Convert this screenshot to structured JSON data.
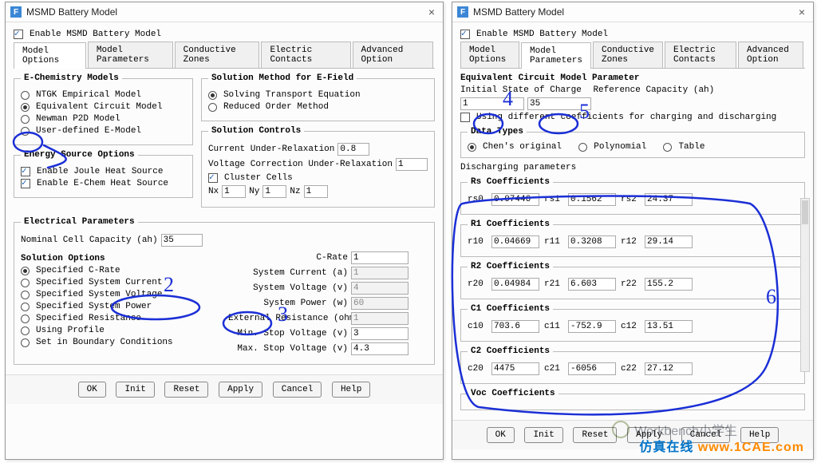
{
  "watermark": {
    "name": "Workbench小学生",
    "site_cn": "仿真在线",
    "site_url": "www.1CAE.com"
  },
  "left": {
    "title": "MSMD Battery Model",
    "enable": "Enable MSMD Battery Model",
    "tabs": [
      "Model Options",
      "Model Parameters",
      "Conductive Zones",
      "Electric Contacts",
      "Advanced Option"
    ],
    "active_tab": 0,
    "echem": {
      "legend": "E-Chemistry Models",
      "options": [
        "NTGK Empirical Model",
        "Equivalent Circuit Model",
        "Newman P2D Model",
        "User-defined E-Model"
      ],
      "selected": 1
    },
    "solmethod": {
      "legend": "Solution Method for E-Field",
      "options": [
        "Solving Transport Equation",
        "Reduced Order Method"
      ],
      "selected": 0
    },
    "energy": {
      "legend": "Energy Source Options",
      "items": [
        "Enable Joule Heat Source",
        "Enable E-Chem Heat Source"
      ]
    },
    "controls": {
      "legend": "Solution Controls",
      "cur_label": "Current Under-Relaxation",
      "cur": "0.8",
      "vcr_label": "Voltage Correction Under-Relaxation",
      "vcr": "1",
      "cluster": "Cluster Cells",
      "nx_label": "Nx",
      "nx": "1",
      "ny_label": "Ny",
      "ny": "1",
      "nz_label": "Nz",
      "nz": "1"
    },
    "elec": {
      "legend": "Electrical Parameters",
      "ncc_label": "Nominal Cell Capacity (ah)",
      "ncc": "35",
      "solopt": "Solution Options",
      "opts": [
        "Specified C-Rate",
        "Specified System Current",
        "Specified System Voltage",
        "Specified System Power",
        "Specified Resistance",
        "Using Profile",
        "Set in Boundary Conditions"
      ],
      "opts_sel": 0,
      "crate_label": "C-Rate",
      "crate": "1",
      "sc_label": "System Current (a)",
      "sc": "1",
      "sv_label": "System Voltage (v)",
      "sv": "4",
      "sp_label": "System Power (w)",
      "sp": "60",
      "er_label": "External Resistance (ohm)",
      "er": "1",
      "min_label": "Min. Stop Voltage (v)",
      "min": "3",
      "max_label": "Max. Stop Voltage (v)",
      "max": "4.3"
    },
    "buttons": [
      "OK",
      "Init",
      "Reset",
      "Apply",
      "Cancel",
      "Help"
    ]
  },
  "right": {
    "title": "MSMD Battery Model",
    "enable": "Enable MSMD Battery Model",
    "tabs": [
      "Model Options",
      "Model Parameters",
      "Conductive Zones",
      "Electric Contacts",
      "Advanced Option"
    ],
    "active_tab": 1,
    "ecmp": {
      "legend": "Equivalent Circuit Model Parameter",
      "isoc_label": "Initial State of Charge",
      "isoc": "1",
      "rc_label": "Reference Capacity (ah)",
      "rc": "35",
      "diff": "Using different coefficients for charging and discharging"
    },
    "datatypes": {
      "legend": "Data Types",
      "options": [
        "Chen's original",
        "Polynomial",
        "Table"
      ],
      "selected": 0
    },
    "disch_label": "Discharging parameters",
    "rs": {
      "legend": "Rs Coefficients",
      "k": [
        "rs0",
        "rs1",
        "rs2"
      ],
      "v": [
        "0.07446",
        "0.1562",
        "24.37"
      ]
    },
    "r1": {
      "legend": "R1 Coefficients",
      "k": [
        "r10",
        "r11",
        "r12"
      ],
      "v": [
        "0.04669",
        "0.3208",
        "29.14"
      ]
    },
    "r2": {
      "legend": "R2 Coefficients",
      "k": [
        "r20",
        "r21",
        "r22"
      ],
      "v": [
        "0.04984",
        "6.603",
        "155.2"
      ]
    },
    "c1": {
      "legend": "C1 Coefficients",
      "k": [
        "c10",
        "c11",
        "c12"
      ],
      "v": [
        "703.6",
        "-752.9",
        "13.51"
      ]
    },
    "c2": {
      "legend": "C2 Coefficients",
      "k": [
        "c20",
        "c21",
        "c22"
      ],
      "v": [
        "4475",
        "-6056",
        "27.12"
      ]
    },
    "voc": {
      "legend": "Voc Coefficients"
    },
    "buttons": [
      "OK",
      "Init",
      "Reset",
      "Apply",
      "Cancel",
      "Help"
    ]
  }
}
